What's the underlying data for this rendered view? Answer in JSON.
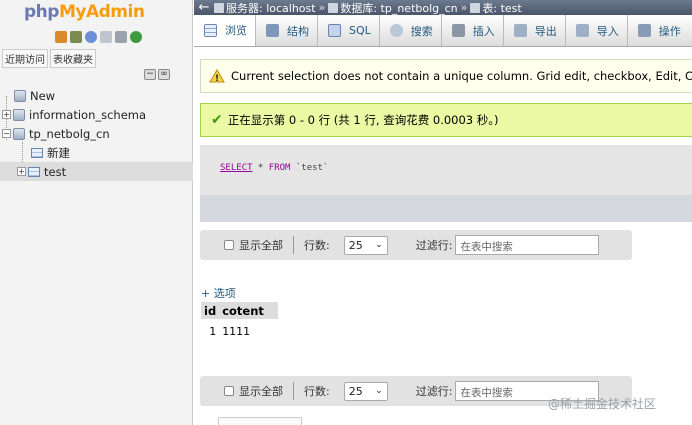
{
  "logo": {
    "part1": "php",
    "part2": "MyAdmin"
  },
  "nav_icons": [
    "home-icon",
    "exit-icon",
    "help-icon",
    "docs-icon",
    "settings-icon",
    "reload-icon"
  ],
  "nav_tabs": [
    "近期访问",
    "表收藏夹"
  ],
  "tree": {
    "new_label": "New",
    "db1": "information_schema",
    "db2": "tp_netbolg_cn",
    "db2_new": "新建",
    "table": "test"
  },
  "breadcrumb": {
    "server": "服务器: localhost",
    "database": "数据库: tp_netbolg_cn",
    "table": "表: test"
  },
  "menu_tabs": [
    "浏览",
    "结构",
    "SQL",
    "搜索",
    "插入",
    "导出",
    "导入",
    "操作"
  ],
  "messages": {
    "warning": "Current selection does not contain a unique column. Grid edit, checkbox, Edit, Copy and",
    "success": "正在显示第 0 - 0 行 (共 1 行, 查询花费 0.0003 秒。)"
  },
  "sql": {
    "kw_select": "SELECT",
    "star": " * ",
    "kw_from": "FROM",
    "table": " `test`"
  },
  "pager": {
    "show_all": "显示全部",
    "rows_label": "行数:",
    "rows_value": "25",
    "filter_label": "过滤行:",
    "filter_placeholder": "在表中搜索"
  },
  "options_link": "+ 选项",
  "result": {
    "columns": [
      "id",
      "cotent"
    ],
    "rows": [
      [
        "1",
        "1111"
      ]
    ]
  },
  "watermark": "@稀土掘金技术社区",
  "colors": {
    "link": "#235a81",
    "success_bg": "#ebf8a4",
    "warning_bg": "#ffffee",
    "crumb_bg": "#4a5668"
  }
}
